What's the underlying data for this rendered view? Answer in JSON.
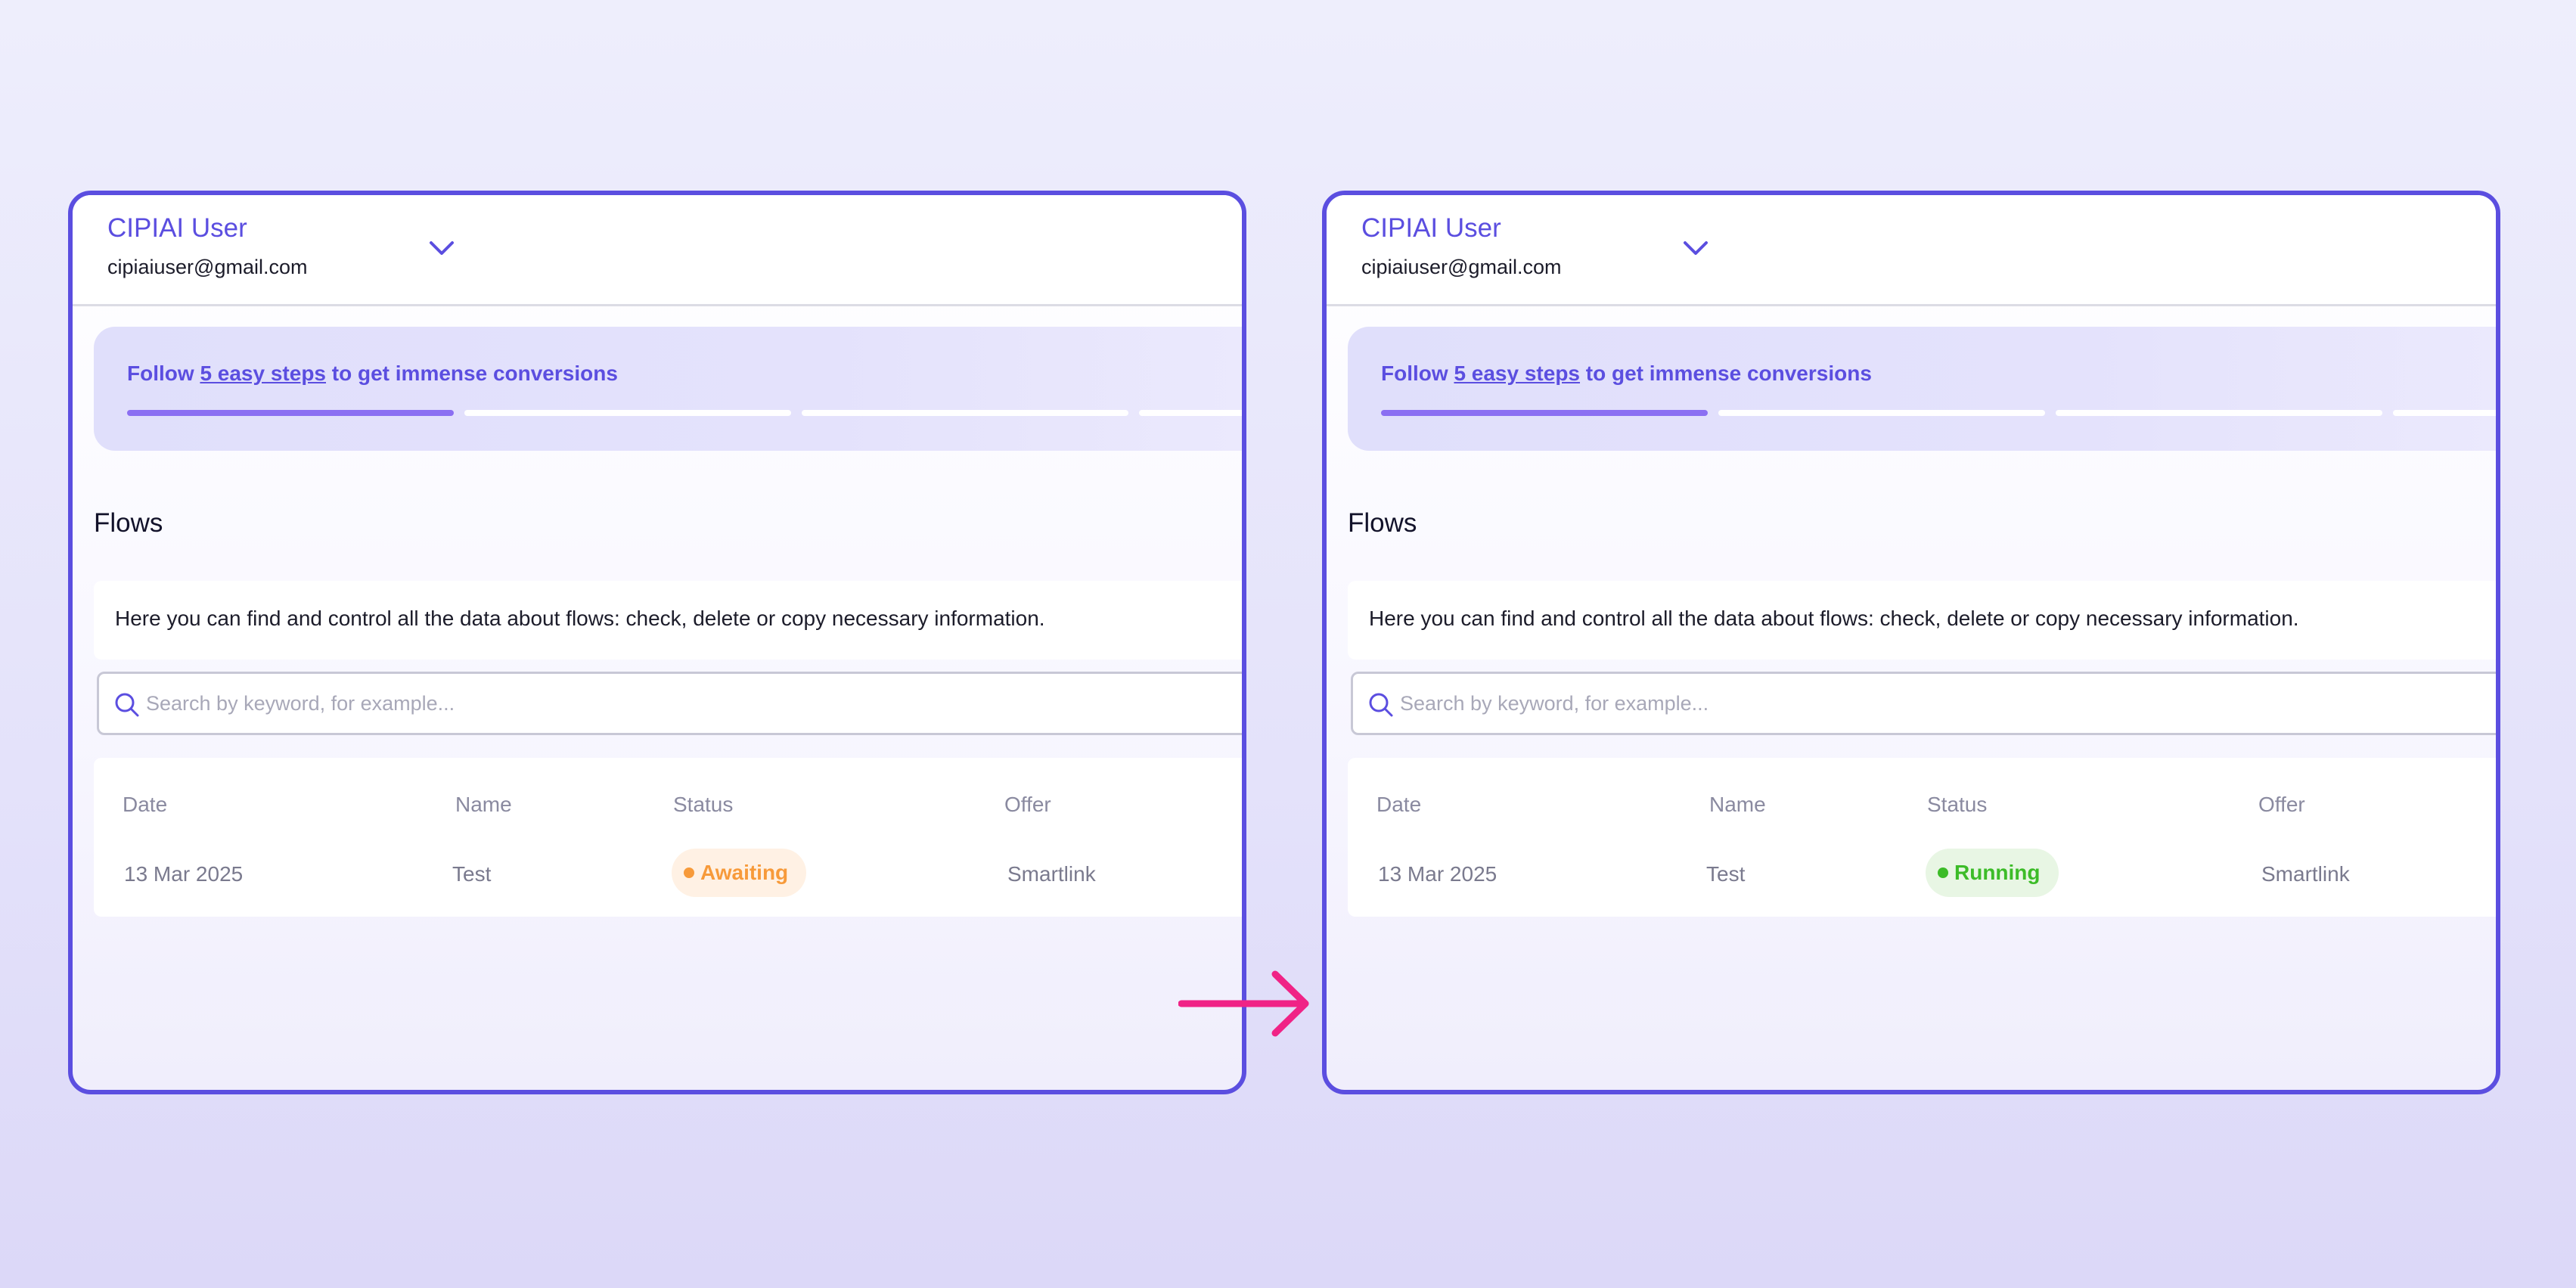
{
  "arrow_color": "#f02386",
  "accent_color": "#5b4ee0",
  "panels": [
    {
      "header": {
        "user_name": "CIPIAI User",
        "user_email": "cipiaiuser@gmail.com"
      },
      "banner": {
        "prefix": "Follow ",
        "link": "5 easy steps",
        "suffix": " to get immense conversions",
        "steps_completed": 1
      },
      "flows": {
        "title": "Flows",
        "description": "Here you can find and control all the data about flows: check, delete or copy necessary information.",
        "search_placeholder": "Search by keyword, for example...",
        "columns": [
          "Date",
          "Name",
          "Status",
          "Offer"
        ],
        "row": {
          "date": "13 Mar 2025",
          "name": "Test",
          "status": "Awaiting",
          "status_color": "#f79a3a",
          "offer": "Smartlink"
        }
      }
    },
    {
      "header": {
        "user_name": "CIPIAI User",
        "user_email": "cipiaiuser@gmail.com"
      },
      "banner": {
        "prefix": "Follow ",
        "link": "5 easy steps",
        "suffix": " to get immense conversions",
        "steps_completed": 1
      },
      "flows": {
        "title": "Flows",
        "description": "Here you can find and control all the data about flows: check, delete or copy necessary information.",
        "search_placeholder": "Search by keyword, for example...",
        "columns": [
          "Date",
          "Name",
          "Status",
          "Offer"
        ],
        "row": {
          "date": "13 Mar 2025",
          "name": "Test",
          "status": "Running",
          "status_color": "#3cbc28",
          "offer": "Smartlink"
        }
      }
    }
  ]
}
